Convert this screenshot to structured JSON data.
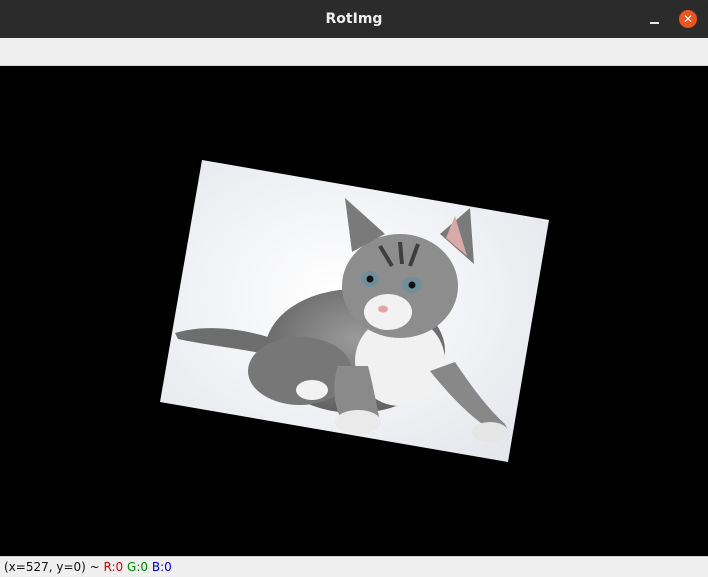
{
  "window": {
    "title": "RotImg"
  },
  "status": {
    "coords": "(x=527, y=0) ~",
    "r": "R:0",
    "g": "G:0",
    "b": "B:0"
  },
  "colors": {
    "close_button": "#e95420",
    "canvas_background": "#000000",
    "red_text": "#e00000",
    "green_text": "#008a00",
    "blue_text": "#0000e0"
  },
  "icons": {
    "minimize": "minimize-icon",
    "close": "close-icon"
  }
}
